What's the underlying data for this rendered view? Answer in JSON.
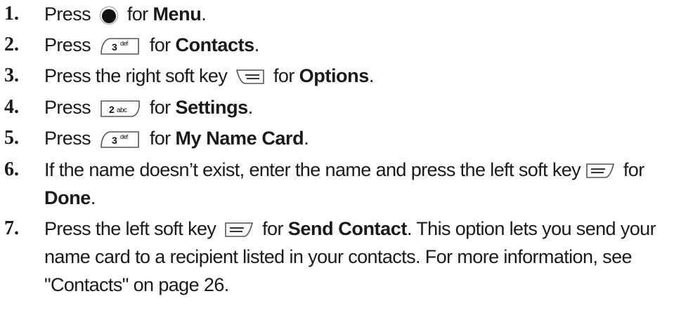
{
  "steps": [
    {
      "num": "1.",
      "pre": "Press",
      "icon": "center-key-icon",
      "mid": "for",
      "bold": "Menu",
      "post": "."
    },
    {
      "num": "2.",
      "pre": "Press",
      "icon": "key-3-def-icon",
      "key_text": "3",
      "key_sub": "def",
      "mid": "for",
      "bold": "Contacts",
      "post": "."
    },
    {
      "num": "3.",
      "pre": "Press the right soft key",
      "icon": "right-soft-key-icon",
      "mid": "for",
      "bold": "Options",
      "post": "."
    },
    {
      "num": "4.",
      "pre": "Press",
      "icon": "key-2-abc-icon",
      "key_text": "2",
      "key_sub": "abc",
      "mid": "for",
      "bold": "Settings",
      "post": "."
    },
    {
      "num": "5.",
      "pre": "Press",
      "icon": "key-3-def-icon",
      "key_text": "3",
      "key_sub": "def",
      "mid": "for",
      "bold": "My Name Card",
      "post": "."
    },
    {
      "num": "6.",
      "pre": "If the name doesn’t exist, enter the name and press the left soft key",
      "icon": "left-soft-key-icon",
      "mid": "for",
      "bold": "Done",
      "post": "."
    },
    {
      "num": "7.",
      "pre": "Press the left soft key",
      "icon": "left-soft-key-icon",
      "mid": "for",
      "bold": "Send Contact",
      "post": ". This option lets you send your name card to a recipient listed in your contacts. For more information, see \"Contacts\" on page 26."
    }
  ]
}
